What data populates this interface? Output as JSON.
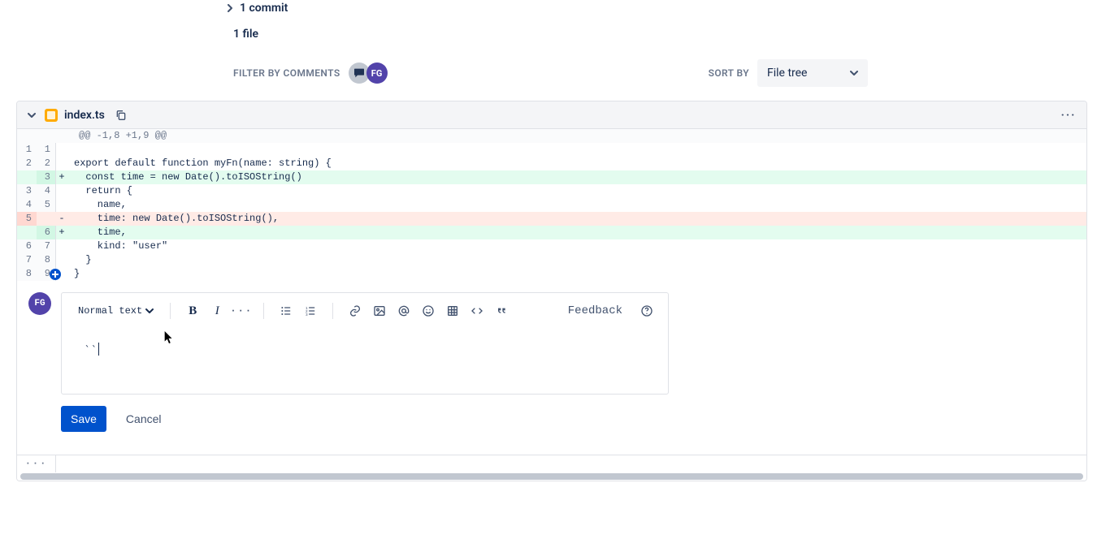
{
  "summary": {
    "commits": "1 commit",
    "files": "1 file"
  },
  "filter": {
    "label": "FILTER BY COMMENTS",
    "avatar": "FG"
  },
  "sort": {
    "label": "SORT BY",
    "value": "File tree"
  },
  "file": {
    "name": "index.ts",
    "hunk": "@@ -1,8 +1,9 @@"
  },
  "diff": [
    {
      "old": "1",
      "new": "1",
      "type": "ctx",
      "text": ""
    },
    {
      "old": "2",
      "new": "2",
      "type": "ctx",
      "text": "export default function myFn(name: string) {"
    },
    {
      "old": "",
      "new": "3",
      "type": "add",
      "text": "  const time = new Date().toISOString()"
    },
    {
      "old": "3",
      "new": "4",
      "type": "ctx",
      "text": "  return {"
    },
    {
      "old": "4",
      "new": "5",
      "type": "ctx",
      "text": "    name,"
    },
    {
      "old": "5",
      "new": "",
      "type": "del",
      "text": "    time: new Date().toISOString(),"
    },
    {
      "old": "",
      "new": "6",
      "type": "add",
      "text": "    time,"
    },
    {
      "old": "6",
      "new": "7",
      "type": "ctx",
      "text": "    kind: \"user\""
    },
    {
      "old": "7",
      "new": "8",
      "type": "ctx",
      "text": "  }"
    },
    {
      "old": "8",
      "new": "9",
      "type": "ctx",
      "text": "}",
      "marker": true
    }
  ],
  "editor": {
    "avatar": "FG",
    "style": "Normal text",
    "content": "``",
    "feedback": "Feedback"
  },
  "actions": {
    "save": "Save",
    "cancel": "Cancel"
  }
}
